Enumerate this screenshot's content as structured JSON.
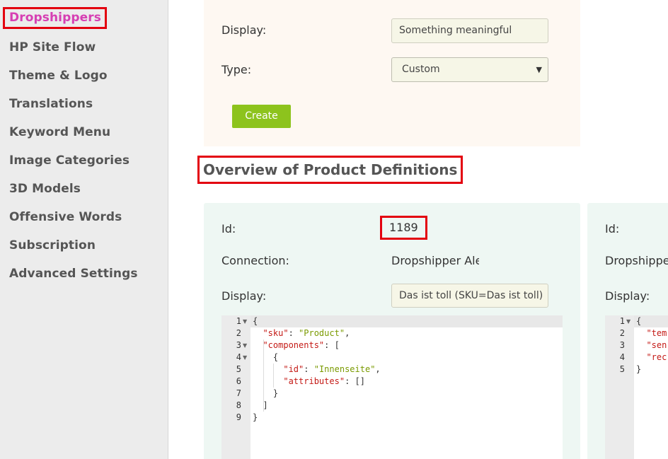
{
  "sidebar": {
    "items": [
      {
        "label": "Dropshippers",
        "active": true
      },
      {
        "label": "HP Site Flow"
      },
      {
        "label": "Theme & Logo"
      },
      {
        "label": "Translations"
      },
      {
        "label": "Keyword Menu"
      },
      {
        "label": "Image Categories"
      },
      {
        "label": "3D Models"
      },
      {
        "label": "Offensive Words"
      },
      {
        "label": "Subscription"
      },
      {
        "label": "Advanced Settings"
      }
    ]
  },
  "create_form": {
    "display_label": "Display:",
    "display_value": "Something meaningful",
    "type_label": "Type:",
    "type_value": "Custom",
    "create_button": "Create"
  },
  "overview": {
    "title": "Overview of Product Definitions",
    "cards": [
      {
        "id_label": "Id:",
        "id_value": "1189",
        "connection_label": "Connection:",
        "connection_value": "Dropshipper Ale",
        "display_label": "Display:",
        "display_value": "Das ist toll (SKU=Das ist toll)",
        "code_lines": [
          {
            "n": "1",
            "fold": true
          },
          {
            "n": "2",
            "key": "\"sku\"",
            "val": "\"Product\"",
            "tail": ","
          },
          {
            "n": "3",
            "fold": true,
            "key": "\"components\"",
            "tail": "["
          },
          {
            "n": "4",
            "fold": true,
            "text": "{"
          },
          {
            "n": "5",
            "key": "\"id\"",
            "val": "\"Innenseite\"",
            "tail": ","
          },
          {
            "n": "6",
            "key": "\"attributes\"",
            "tail": "[]"
          },
          {
            "n": "7",
            "text": "}"
          },
          {
            "n": "8",
            "text": "]"
          },
          {
            "n": "9",
            "text": "}"
          }
        ]
      },
      {
        "id_label": "Id:",
        "connection_value": "Dropshippe",
        "display_label": "Display:",
        "code_lines": [
          {
            "n": "1",
            "fold": true
          },
          {
            "n": "2",
            "key": "\"tem"
          },
          {
            "n": "3",
            "key": "\"sen"
          },
          {
            "n": "4",
            "key": "\"rec"
          },
          {
            "n": "5",
            "text": "}"
          }
        ]
      }
    ]
  },
  "colors": {
    "active_nav": "#d63fb3",
    "highlight_box": "#e3000f",
    "create_button": "#8dc31d",
    "create_card_bg": "#fef8f2",
    "definition_card_bg": "#eef7f3"
  }
}
